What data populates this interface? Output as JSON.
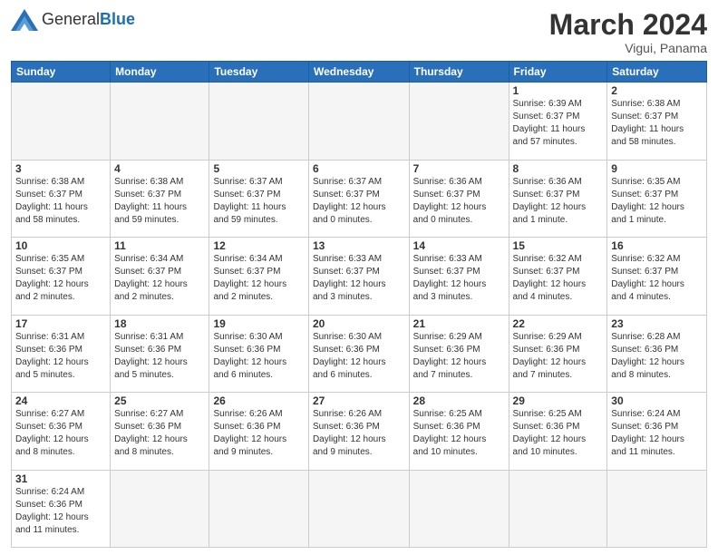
{
  "header": {
    "logo_general": "General",
    "logo_blue": "Blue",
    "month_title": "March 2024",
    "location": "Vigui, Panama"
  },
  "days_of_week": [
    "Sunday",
    "Monday",
    "Tuesday",
    "Wednesday",
    "Thursday",
    "Friday",
    "Saturday"
  ],
  "weeks": [
    [
      {
        "day": "",
        "info": "",
        "empty": true
      },
      {
        "day": "",
        "info": "",
        "empty": true
      },
      {
        "day": "",
        "info": "",
        "empty": true
      },
      {
        "day": "",
        "info": "",
        "empty": true
      },
      {
        "day": "",
        "info": "",
        "empty": true
      },
      {
        "day": "1",
        "info": "Sunrise: 6:39 AM\nSunset: 6:37 PM\nDaylight: 11 hours\nand 57 minutes."
      },
      {
        "day": "2",
        "info": "Sunrise: 6:38 AM\nSunset: 6:37 PM\nDaylight: 11 hours\nand 58 minutes."
      }
    ],
    [
      {
        "day": "3",
        "info": "Sunrise: 6:38 AM\nSunset: 6:37 PM\nDaylight: 11 hours\nand 58 minutes."
      },
      {
        "day": "4",
        "info": "Sunrise: 6:38 AM\nSunset: 6:37 PM\nDaylight: 11 hours\nand 59 minutes."
      },
      {
        "day": "5",
        "info": "Sunrise: 6:37 AM\nSunset: 6:37 PM\nDaylight: 11 hours\nand 59 minutes."
      },
      {
        "day": "6",
        "info": "Sunrise: 6:37 AM\nSunset: 6:37 PM\nDaylight: 12 hours\nand 0 minutes."
      },
      {
        "day": "7",
        "info": "Sunrise: 6:36 AM\nSunset: 6:37 PM\nDaylight: 12 hours\nand 0 minutes."
      },
      {
        "day": "8",
        "info": "Sunrise: 6:36 AM\nSunset: 6:37 PM\nDaylight: 12 hours\nand 1 minute."
      },
      {
        "day": "9",
        "info": "Sunrise: 6:35 AM\nSunset: 6:37 PM\nDaylight: 12 hours\nand 1 minute."
      }
    ],
    [
      {
        "day": "10",
        "info": "Sunrise: 6:35 AM\nSunset: 6:37 PM\nDaylight: 12 hours\nand 2 minutes."
      },
      {
        "day": "11",
        "info": "Sunrise: 6:34 AM\nSunset: 6:37 PM\nDaylight: 12 hours\nand 2 minutes."
      },
      {
        "day": "12",
        "info": "Sunrise: 6:34 AM\nSunset: 6:37 PM\nDaylight: 12 hours\nand 2 minutes."
      },
      {
        "day": "13",
        "info": "Sunrise: 6:33 AM\nSunset: 6:37 PM\nDaylight: 12 hours\nand 3 minutes."
      },
      {
        "day": "14",
        "info": "Sunrise: 6:33 AM\nSunset: 6:37 PM\nDaylight: 12 hours\nand 3 minutes."
      },
      {
        "day": "15",
        "info": "Sunrise: 6:32 AM\nSunset: 6:37 PM\nDaylight: 12 hours\nand 4 minutes."
      },
      {
        "day": "16",
        "info": "Sunrise: 6:32 AM\nSunset: 6:37 PM\nDaylight: 12 hours\nand 4 minutes."
      }
    ],
    [
      {
        "day": "17",
        "info": "Sunrise: 6:31 AM\nSunset: 6:36 PM\nDaylight: 12 hours\nand 5 minutes."
      },
      {
        "day": "18",
        "info": "Sunrise: 6:31 AM\nSunset: 6:36 PM\nDaylight: 12 hours\nand 5 minutes."
      },
      {
        "day": "19",
        "info": "Sunrise: 6:30 AM\nSunset: 6:36 PM\nDaylight: 12 hours\nand 6 minutes."
      },
      {
        "day": "20",
        "info": "Sunrise: 6:30 AM\nSunset: 6:36 PM\nDaylight: 12 hours\nand 6 minutes."
      },
      {
        "day": "21",
        "info": "Sunrise: 6:29 AM\nSunset: 6:36 PM\nDaylight: 12 hours\nand 7 minutes."
      },
      {
        "day": "22",
        "info": "Sunrise: 6:29 AM\nSunset: 6:36 PM\nDaylight: 12 hours\nand 7 minutes."
      },
      {
        "day": "23",
        "info": "Sunrise: 6:28 AM\nSunset: 6:36 PM\nDaylight: 12 hours\nand 8 minutes."
      }
    ],
    [
      {
        "day": "24",
        "info": "Sunrise: 6:27 AM\nSunset: 6:36 PM\nDaylight: 12 hours\nand 8 minutes."
      },
      {
        "day": "25",
        "info": "Sunrise: 6:27 AM\nSunset: 6:36 PM\nDaylight: 12 hours\nand 8 minutes."
      },
      {
        "day": "26",
        "info": "Sunrise: 6:26 AM\nSunset: 6:36 PM\nDaylight: 12 hours\nand 9 minutes."
      },
      {
        "day": "27",
        "info": "Sunrise: 6:26 AM\nSunset: 6:36 PM\nDaylight: 12 hours\nand 9 minutes."
      },
      {
        "day": "28",
        "info": "Sunrise: 6:25 AM\nSunset: 6:36 PM\nDaylight: 12 hours\nand 10 minutes."
      },
      {
        "day": "29",
        "info": "Sunrise: 6:25 AM\nSunset: 6:36 PM\nDaylight: 12 hours\nand 10 minutes."
      },
      {
        "day": "30",
        "info": "Sunrise: 6:24 AM\nSunset: 6:36 PM\nDaylight: 12 hours\nand 11 minutes."
      }
    ],
    [
      {
        "day": "31",
        "info": "Sunrise: 6:24 AM\nSunset: 6:36 PM\nDaylight: 12 hours\nand 11 minutes.",
        "last_row": true
      },
      {
        "day": "",
        "info": "",
        "empty": true,
        "last_row": true
      },
      {
        "day": "",
        "info": "",
        "empty": true,
        "last_row": true
      },
      {
        "day": "",
        "info": "",
        "empty": true,
        "last_row": true
      },
      {
        "day": "",
        "info": "",
        "empty": true,
        "last_row": true
      },
      {
        "day": "",
        "info": "",
        "empty": true,
        "last_row": true
      },
      {
        "day": "",
        "info": "",
        "empty": true,
        "last_row": true
      }
    ]
  ]
}
